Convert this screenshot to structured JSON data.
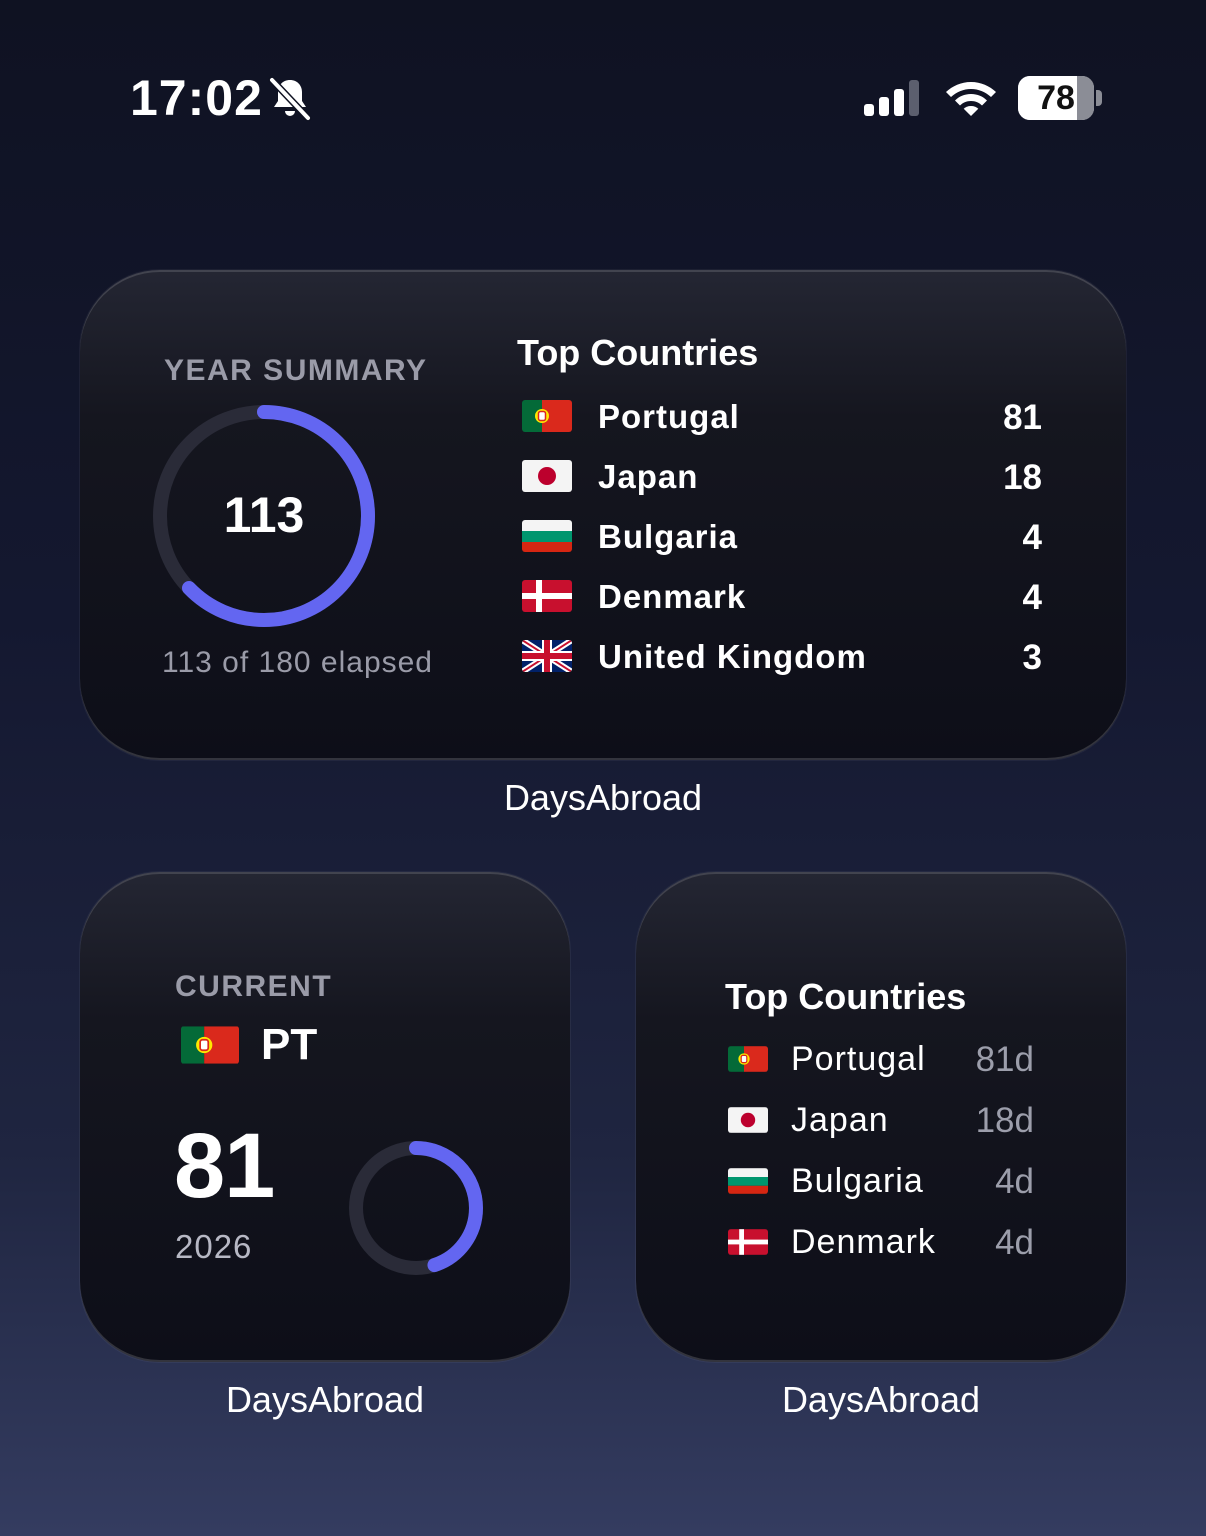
{
  "status_bar": {
    "time": "17:02",
    "battery": "78",
    "battery_level": 0.78
  },
  "colors": {
    "accent": "#6366f1",
    "ring_track": "#2a2b38"
  },
  "widget_year_summary": {
    "label": "YEAR SUMMARY",
    "ring_value": "113",
    "ring_progress": 0.628,
    "elapsed_text": "113 of 180 elapsed",
    "top_title": "Top Countries",
    "countries": [
      {
        "name": "Portugal",
        "value": "81",
        "flag": "pt-flag"
      },
      {
        "name": "Japan",
        "value": "18",
        "flag": "jp-flag"
      },
      {
        "name": "Bulgaria",
        "value": "4",
        "flag": "bg-flag"
      },
      {
        "name": "Denmark",
        "value": "4",
        "flag": "dk-flag"
      },
      {
        "name": "United Kingdom",
        "value": "3",
        "flag": "gb-flag"
      }
    ],
    "caption": "DaysAbroad"
  },
  "widget_current": {
    "label": "CURRENT",
    "country_code": "PT",
    "flag": "pt-flag",
    "days": "81",
    "year": "2026",
    "ring_progress": 0.45,
    "caption": "DaysAbroad"
  },
  "widget_top": {
    "title": "Top Countries",
    "countries": [
      {
        "name": "Portugal",
        "value": "81d",
        "flag": "pt-flag"
      },
      {
        "name": "Japan",
        "value": "18d",
        "flag": "jp-flag"
      },
      {
        "name": "Bulgaria",
        "value": "4d",
        "flag": "bg-flag"
      },
      {
        "name": "Denmark",
        "value": "4d",
        "flag": "dk-flag"
      }
    ],
    "caption": "DaysAbroad"
  }
}
